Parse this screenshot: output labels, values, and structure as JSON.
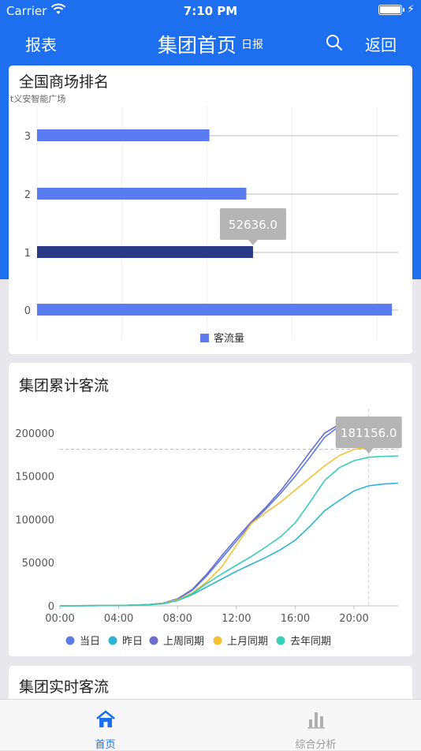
{
  "status_bar": {
    "carrier": "Carrier",
    "time": "7:10 PM"
  },
  "nav": {
    "left_label": "报表",
    "title": "集团首页",
    "subtitle": "日报",
    "search_icon": "search-icon",
    "back_label": "返回"
  },
  "colors": {
    "brand": "#1e6ff0",
    "bar": "#5b7bf0",
    "bar_selected": "#2b3a86",
    "tooltip": "#b5b5b5",
    "tab_active": "#1e6ff0",
    "tab_inactive": "#999999"
  },
  "ranking_card": {
    "title": "全国商场排名",
    "clipped_label": "t义安智能广场",
    "tooltip": "52636.0",
    "chart_data": {
      "type": "bar",
      "orientation": "horizontal",
      "categories": [
        "0",
        "1",
        "2",
        "3"
      ],
      "series": [
        {
          "name": "客流量",
          "values": [
            86500,
            52636,
            51000,
            42000
          ]
        }
      ],
      "xlim": [
        0,
        88000
      ],
      "selected_index": 1,
      "legend": "bottom-center",
      "grid": true
    }
  },
  "cumulative_card": {
    "title": "集团累计客流",
    "tooltip": "181156.0",
    "chart_data": {
      "type": "line",
      "x_ticks": [
        "00:00",
        "04:00",
        "08:00",
        "12:00",
        "16:00",
        "20:00"
      ],
      "x": [
        0,
        2,
        4,
        6,
        7,
        8,
        9,
        10,
        11,
        12,
        13,
        14,
        15,
        16,
        17,
        18,
        19,
        20,
        21,
        22,
        23
      ],
      "ylim": [
        0,
        210000
      ],
      "y_ticks": [
        0,
        50000,
        100000,
        150000,
        200000
      ],
      "y_tick_labels": [
        "0",
        "50000",
        "100000",
        "150000",
        "200000"
      ],
      "reference_y": 181156,
      "reference_x": 21,
      "legend": "bottom-center",
      "series": [
        {
          "name": "当日",
          "color": "#5a7be6",
          "values": [
            0,
            300,
            500,
            1500,
            3000,
            8000,
            18000,
            35000,
            55000,
            75000,
            95000,
            112000,
            130000,
            150000,
            172000,
            195000,
            208000,
            null,
            null,
            null,
            null
          ]
        },
        {
          "name": "昨日",
          "color": "#2bb4d6",
          "values": [
            0,
            200,
            400,
            1200,
            2500,
            6000,
            13000,
            22000,
            31000,
            40000,
            48000,
            56000,
            65000,
            76000,
            92000,
            110000,
            122000,
            133000,
            139000,
            141000,
            142000
          ]
        },
        {
          "name": "上周同期",
          "color": "#6a6ecf",
          "values": [
            0,
            300,
            500,
            1500,
            3000,
            8000,
            19000,
            37000,
            58000,
            78000,
            97000,
            114000,
            133000,
            155000,
            178000,
            200000,
            210000,
            null,
            null,
            null,
            null
          ]
        },
        {
          "name": "上月同期",
          "color": "#f5c033",
          "values": [
            0,
            250,
            450,
            1300,
            2800,
            7000,
            15000,
            28000,
            45000,
            70000,
            95000,
            108000,
            120000,
            134000,
            148000,
            162000,
            174000,
            181156,
            183000,
            184000,
            184500
          ]
        },
        {
          "name": "去年同期",
          "color": "#36cfb5",
          "values": [
            0,
            200,
            400,
            1200,
            2500,
            6000,
            14000,
            26000,
            37000,
            47000,
            57000,
            68000,
            80000,
            96000,
            120000,
            145000,
            160000,
            168000,
            172000,
            173000,
            173500
          ]
        }
      ]
    }
  },
  "realtime_card": {
    "title": "集团实时客流"
  },
  "tabbar": {
    "items": [
      {
        "label": "首页",
        "icon": "home-icon",
        "active": true
      },
      {
        "label": "综合分析",
        "icon": "bar-chart-icon",
        "active": false
      }
    ]
  }
}
